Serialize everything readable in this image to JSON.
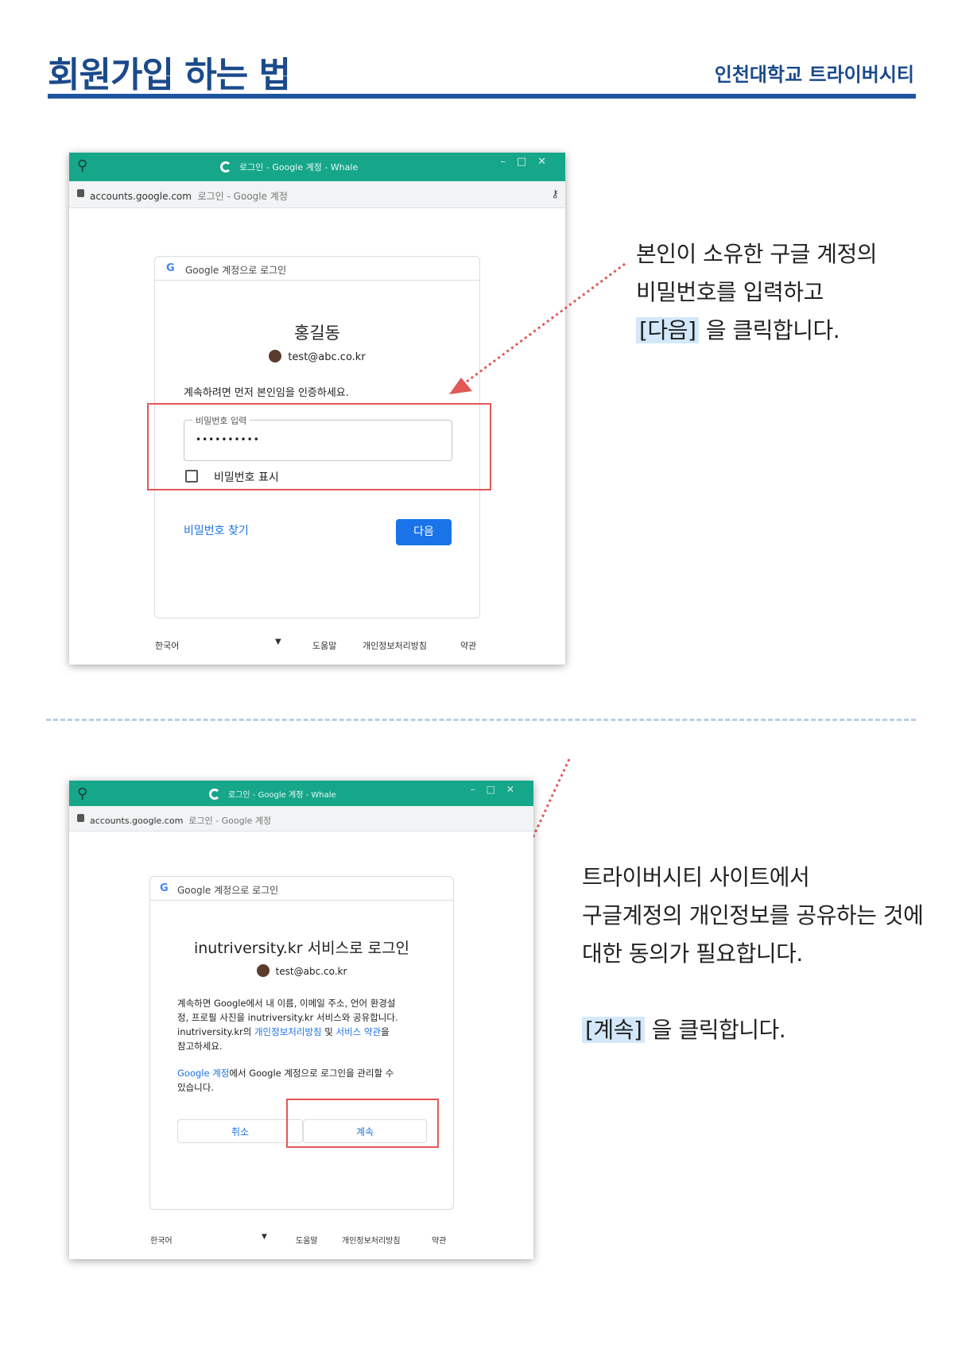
{
  "header": {
    "title": "회원가입 하는 법",
    "org": "인천대학교 트라이버시티"
  },
  "step1": {
    "window_title": "로그인 - Google 계정 - Whale",
    "address_url": "accounts.google.com",
    "address_title": "로그인 - Google 계정",
    "card_header": "Google 계정으로 로그인",
    "user_name": "홍길동",
    "user_email": "test@abc.co.kr",
    "verify_text": "계속하려면 먼저 본인임을 인증하세요.",
    "password_label": "비밀번호 입력",
    "password_value": "••••••••••",
    "show_password_label": "비밀번호 표시",
    "forgot_link": "비밀번호 찾기",
    "next_button": "다음",
    "footer": {
      "language": "한국어",
      "help": "도움말",
      "privacy": "개인정보처리방침",
      "terms": "약관"
    },
    "note_line1": "본인이 소유한 구글 계정의",
    "note_line2": "비밀번호를 입력하고",
    "note_highlight": "[다음]",
    "note_line3_rest": "을 클릭합니다."
  },
  "step2": {
    "window_title": "로그인 - Google 계정 - Whale",
    "address_url": "accounts.google.com",
    "address_title": "로그인 - Google 계정",
    "card_header": "Google 계정으로 로그인",
    "service_title": "inutriversity.kr 서비스로 로그인",
    "user_email": "test@abc.co.kr",
    "consent_line1": "계속하면 Google에서 내 이름, 이메일 주소, 언어 환경설",
    "consent_line2": "정, 프로필 사진을 inutriversity.kr 서비스와 공유합니다.",
    "consent_line3_a": "inutriversity.kr의",
    "consent_privacy_link": "개인정보처리방침",
    "consent_line3_b": "및",
    "consent_terms_link": "서비스 약관",
    "consent_line3_c": "을",
    "consent_line4": "참고하세요.",
    "manage_link": "Google 계정",
    "manage_line1_rest": "에서 Google 계정으로 로그인을 관리할 수",
    "manage_line2": "있습니다.",
    "cancel_button": "취소",
    "continue_button": "계속",
    "footer": {
      "language": "한국어",
      "help": "도움말",
      "privacy": "개인정보처리방침",
      "terms": "약관"
    },
    "note_line1": "트라이버시티 사이트에서",
    "note_line2": "구글계정의 개인정보를 공유하는 것에",
    "note_line3": "대한 동의가 필요합니다.",
    "note_highlight": "[계속]",
    "note_line4_rest": "을 클릭합니다."
  },
  "colors": {
    "brand_blue": "#1b4a8c",
    "window_green": "#16a68a",
    "google_blue": "#1a73e8",
    "callout_red": "#e25757",
    "highlight_bg": "#d3e9fb"
  },
  "icons": [
    "pin-icon",
    "google-icon",
    "lock-icon",
    "key-icon",
    "chevron-down-icon",
    "avatar"
  ]
}
